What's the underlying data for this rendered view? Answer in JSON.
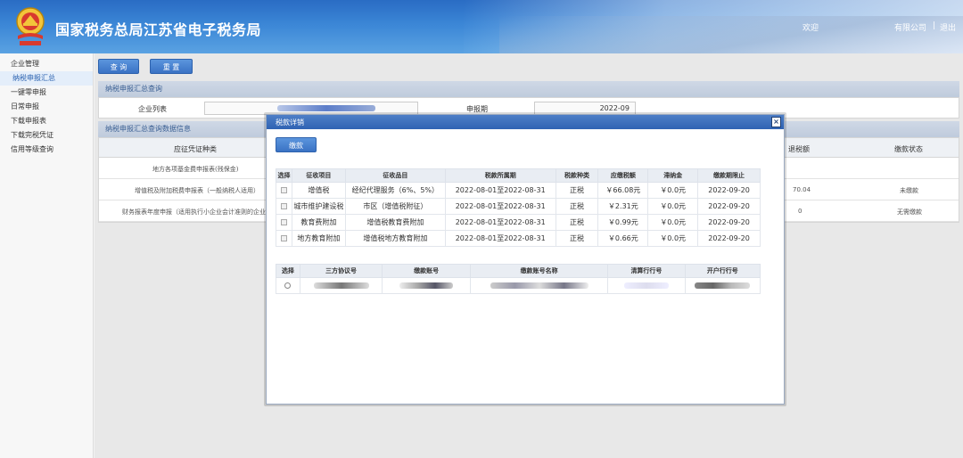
{
  "header": {
    "title": "国家税务总局江苏省电子税务局",
    "welcome": "欢迎",
    "company": "有限公司",
    "separator": "|",
    "logout": "退出"
  },
  "sidebar": {
    "items": [
      {
        "label": "企业管理"
      },
      {
        "label": "纳税申报汇总"
      },
      {
        "label": "一键零申报"
      },
      {
        "label": "日常申报"
      },
      {
        "label": "下载申报表"
      },
      {
        "label": "下载完税凭证"
      },
      {
        "label": "信用等级查询"
      }
    ]
  },
  "toolbar": {
    "query_label": "查 询",
    "reset_label": "重 置"
  },
  "query_section": {
    "title": "纳税申报汇总查询",
    "enterprise_label": "企业列表",
    "period_label": "申报期",
    "period_value": "2022-09"
  },
  "result_section": {
    "title": "纳税申报汇总查询数据信息",
    "col_voucher_type": "应征凭证种类",
    "col_refund": "）退税额",
    "col_status": "缴款状态",
    "rows": [
      {
        "name": "地方各项基金费申报表(残保金)",
        "refund": "",
        "status": ""
      },
      {
        "name": "增值税及附加税费申报表（一般纳税人适用）",
        "refund": "70.04",
        "status": "未缴款"
      },
      {
        "name": "财务报表年度申报（适用执行小企业会计准则的企业）",
        "refund": "0",
        "status": "无需缴款"
      }
    ]
  },
  "modal": {
    "title": "税款详销",
    "pay_button": "缴款",
    "close_label": "×",
    "tax_table": {
      "headers": [
        "选择",
        "征收项目",
        "征收品目",
        "税款所属期",
        "税款种类",
        "应缴税额",
        "滞纳金",
        "缴款期限止"
      ],
      "rows": [
        {
          "item": "增值税",
          "sub": "经纪代理服务（6%、5%）",
          "period": "2022-08-01至2022-08-31",
          "kind": "正税",
          "amount": "￥66.08元",
          "late": "￥0.0元",
          "deadline": "2022-09-20"
        },
        {
          "item": "城市维护建设税",
          "sub": "市区（增值税附征）",
          "period": "2022-08-01至2022-08-31",
          "kind": "正税",
          "amount": "￥2.31元",
          "late": "￥0.0元",
          "deadline": "2022-09-20"
        },
        {
          "item": "教育费附加",
          "sub": "增值税教育费附加",
          "period": "2022-08-01至2022-08-31",
          "kind": "正税",
          "amount": "￥0.99元",
          "late": "￥0.0元",
          "deadline": "2022-09-20"
        },
        {
          "item": "地方教育附加",
          "sub": "增值税地方教育附加",
          "period": "2022-08-01至2022-08-31",
          "kind": "正税",
          "amount": "￥0.66元",
          "late": "￥0.0元",
          "deadline": "2022-09-20"
        }
      ]
    },
    "account_table": {
      "headers": [
        "选择",
        "三方协议号",
        "缴款账号",
        "缴款账号名称",
        "清算行行号",
        "开户行行号"
      ]
    }
  },
  "colors": {
    "header_blue": "#2a6cc4",
    "button_blue": "#3a72c4",
    "status_unpaid": "#d23a3a",
    "status_nopay": "#2f9a3a"
  }
}
